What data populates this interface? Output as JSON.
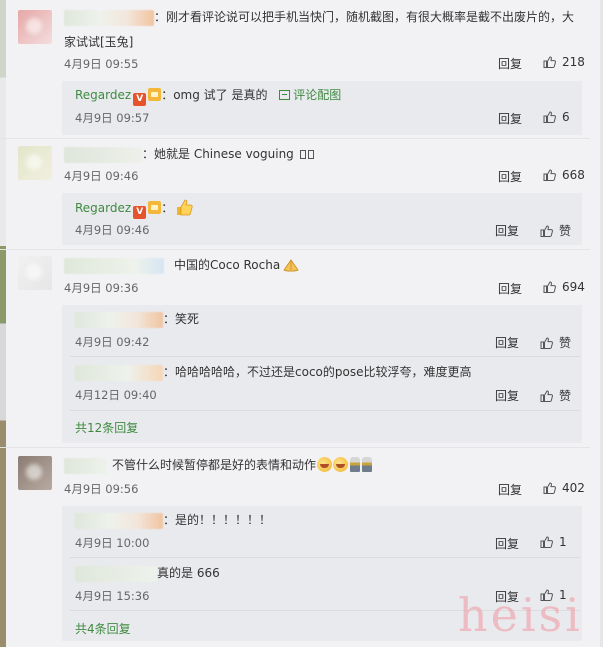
{
  "comments": [
    {
      "text": "：刚才看评论说可以把手机当快门，随机截图，有很大概率是截不出废片的，大",
      "text_line2": "家试试[玉兔]",
      "time": "4月9日 09:55",
      "reply_label": "回复",
      "likes": "218",
      "replies": [
        {
          "user": "Regardez",
          "text": "：omg 试了 是真的",
          "link": "评论配图",
          "time": "4月9日 09:57",
          "reply_label": "回复",
          "likes": "6"
        }
      ]
    },
    {
      "text": "：她就是 Chinese voguing",
      "time": "4月9日 09:46",
      "reply_label": "回复",
      "likes": "668",
      "replies": [
        {
          "user": "Regardez",
          "text": "：",
          "time": "4月9日 09:46",
          "reply_label": "回复",
          "likes": "赞"
        }
      ]
    },
    {
      "text": "中国的Coco Rocha",
      "time": "4月9日 09:36",
      "reply_label": "回复",
      "likes": "694",
      "replies": [
        {
          "text": "：笑死",
          "time": "4月9日 09:42",
          "reply_label": "回复",
          "likes": "赞"
        },
        {
          "text": "：哈哈哈哈哈，不过还是coco的pose比较浮夸，难度更高",
          "time": "4月12日 09:40",
          "reply_label": "回复",
          "likes": "赞"
        }
      ],
      "more": "共12条回复"
    },
    {
      "text": "不管什么时候暂停都是好的表情和动作",
      "time": "4月9日 09:56",
      "reply_label": "回复",
      "likes": "402",
      "replies": [
        {
          "text": "：是的！！！！！！",
          "time": "4月9日 10:00",
          "reply_label": "回复",
          "likes": "1"
        },
        {
          "text": "真的是 666",
          "time": "4月9日 15:36",
          "reply_label": "回复",
          "likes": "1"
        }
      ],
      "more": "共4条回复"
    }
  ],
  "watermark": "heisi",
  "colors": {
    "link": "#3f8a41",
    "background": "#f2f2f5",
    "reply_bg": "#e9eaee",
    "watermark": "#f096a0"
  }
}
